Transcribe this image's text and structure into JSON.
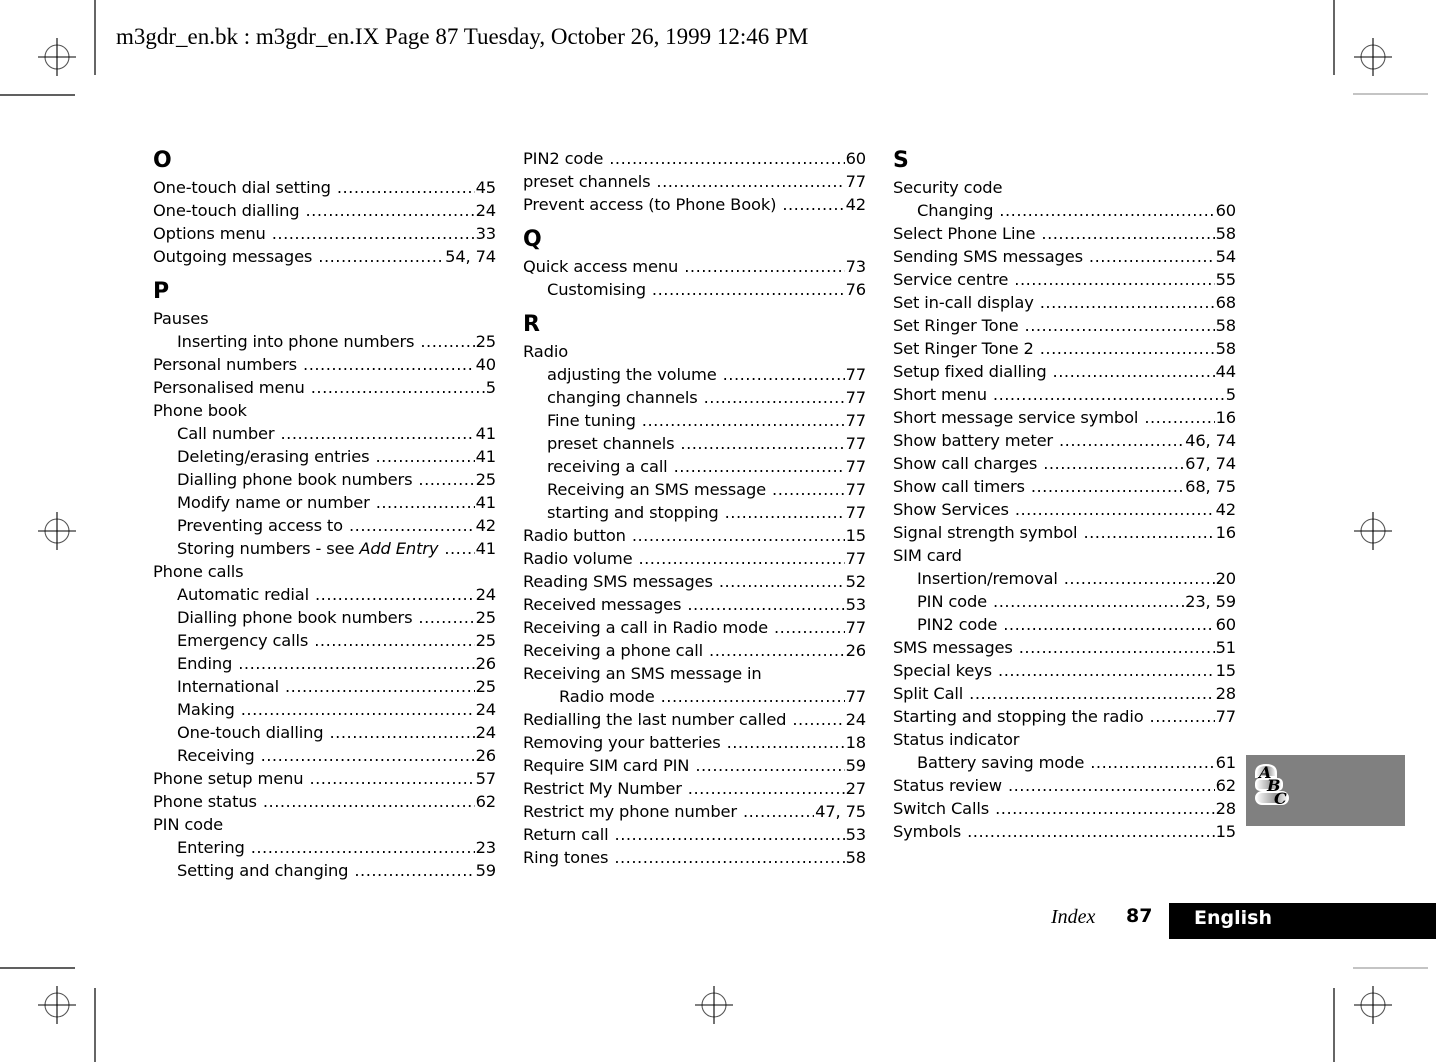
{
  "header": {
    "text": "m3gdr_en.bk : m3gdr_en.IX  Page 87  Tuesday, October 26, 1999  12:46 PM"
  },
  "columns": [
    {
      "items": [
        {
          "type": "letter",
          "text": "O"
        },
        {
          "type": "entry",
          "term": "One-touch dial setting",
          "page": "45"
        },
        {
          "type": "entry",
          "term": "One-touch dialling",
          "page": "24"
        },
        {
          "type": "entry",
          "term": "Options menu",
          "page": "33"
        },
        {
          "type": "entry",
          "term": "Outgoing messages",
          "page": "54, 74"
        },
        {
          "type": "letter",
          "text": "P"
        },
        {
          "type": "heading",
          "term": "Pauses"
        },
        {
          "type": "sub",
          "term": "Inserting into phone numbers",
          "page": "25"
        },
        {
          "type": "entry",
          "term": "Personal numbers",
          "page": "40"
        },
        {
          "type": "entry",
          "term": "Personalised menu",
          "page": "5"
        },
        {
          "type": "heading",
          "term": "Phone book"
        },
        {
          "type": "sub",
          "term": "Call number",
          "page": "41"
        },
        {
          "type": "sub",
          "term": "Deleting/erasing entries",
          "page": "41"
        },
        {
          "type": "sub",
          "term": "Dialling phone book numbers",
          "page": "25"
        },
        {
          "type": "sub",
          "term": "Modify name or number",
          "page": "41"
        },
        {
          "type": "sub",
          "term": "Preventing access to",
          "page": "42"
        },
        {
          "type": "sub",
          "term": "Storing numbers - see ",
          "term_italic": "Add Entry",
          "page": "41"
        },
        {
          "type": "heading",
          "term": "Phone calls"
        },
        {
          "type": "sub",
          "term": "Automatic redial",
          "page": "24"
        },
        {
          "type": "sub",
          "term": "Dialling phone book numbers",
          "page": "25"
        },
        {
          "type": "sub",
          "term": "Emergency calls",
          "page": "25"
        },
        {
          "type": "sub",
          "term": "Ending",
          "page": "26"
        },
        {
          "type": "sub",
          "term": "International",
          "page": "25"
        },
        {
          "type": "sub",
          "term": "Making",
          "page": "24"
        },
        {
          "type": "sub",
          "term": "One-touch dialling",
          "page": "24"
        },
        {
          "type": "sub",
          "term": "Receiving",
          "page": "26"
        },
        {
          "type": "entry",
          "term": "Phone setup menu",
          "page": "57"
        },
        {
          "type": "entry",
          "term": "Phone status",
          "page": "62"
        },
        {
          "type": "heading",
          "term": "PIN code"
        },
        {
          "type": "sub",
          "term": "Entering",
          "page": "23"
        },
        {
          "type": "sub",
          "term": "Setting and changing",
          "page": "59"
        }
      ]
    },
    {
      "items": [
        {
          "type": "entry",
          "term": "PIN2 code",
          "page": "60"
        },
        {
          "type": "entry",
          "term": "preset channels",
          "page": "77"
        },
        {
          "type": "entry",
          "term": "Prevent access (to Phone Book)",
          "page": "42"
        },
        {
          "type": "letter",
          "text": "Q"
        },
        {
          "type": "entry",
          "term": "Quick access menu",
          "page": "73"
        },
        {
          "type": "sub",
          "term": "Customising",
          "page": "76"
        },
        {
          "type": "letter",
          "text": "R"
        },
        {
          "type": "heading",
          "term": "Radio"
        },
        {
          "type": "sub",
          "term": "adjusting the volume",
          "page": "77"
        },
        {
          "type": "sub",
          "term": "changing channels",
          "page": "77"
        },
        {
          "type": "sub",
          "term": "Fine tuning",
          "page": "77"
        },
        {
          "type": "sub",
          "term": "preset channels",
          "page": "77"
        },
        {
          "type": "sub",
          "term": "receiving a call",
          "page": "77"
        },
        {
          "type": "sub",
          "term": "Receiving an SMS message",
          "page": "77"
        },
        {
          "type": "sub",
          "term": "starting and stopping",
          "page": "77"
        },
        {
          "type": "entry",
          "term": "Radio button",
          "page": "15"
        },
        {
          "type": "entry",
          "term": "Radio volume",
          "page": "77"
        },
        {
          "type": "entry",
          "term": "Reading SMS messages",
          "page": "52"
        },
        {
          "type": "entry",
          "term": "Received messages",
          "page": "53"
        },
        {
          "type": "entry",
          "term": "Receiving a call in Radio mode",
          "page": "77"
        },
        {
          "type": "entry",
          "term": "Receiving a phone call",
          "page": "26"
        },
        {
          "type": "heading",
          "term": "Receiving an SMS message in"
        },
        {
          "type": "sub2",
          "term": "Radio mode",
          "page": "77"
        },
        {
          "type": "entry",
          "term": "Redialling the last number called",
          "page": "24"
        },
        {
          "type": "entry",
          "term": "Removing your batteries",
          "page": "18"
        },
        {
          "type": "entry",
          "term": "Require SIM card PIN",
          "page": "59"
        },
        {
          "type": "entry",
          "term": "Restrict My Number",
          "page": "27"
        },
        {
          "type": "entry",
          "term": "Restrict my phone number",
          "page": "47, 75"
        },
        {
          "type": "entry",
          "term": "Return call",
          "page": "53"
        },
        {
          "type": "entry",
          "term": "Ring tones",
          "page": "58"
        }
      ]
    },
    {
      "items": [
        {
          "type": "letter",
          "text": "S"
        },
        {
          "type": "heading",
          "term": "Security code"
        },
        {
          "type": "sub",
          "term": "Changing",
          "page": "60"
        },
        {
          "type": "entry",
          "term": "Select Phone Line",
          "page": "58"
        },
        {
          "type": "entry",
          "term": "Sending SMS messages",
          "page": "54"
        },
        {
          "type": "entry",
          "term": "Service centre",
          "page": "55"
        },
        {
          "type": "entry",
          "term": "Set in-call display",
          "page": "68"
        },
        {
          "type": "entry",
          "term": "Set Ringer Tone",
          "page": "58"
        },
        {
          "type": "entry",
          "term": "Set Ringer Tone 2",
          "page": "58"
        },
        {
          "type": "entry",
          "term": "Setup fixed dialling",
          "page": "44"
        },
        {
          "type": "entry",
          "term": "Short menu",
          "page": "5"
        },
        {
          "type": "entry",
          "term": "Short message service symbol",
          "page": "16"
        },
        {
          "type": "entry",
          "term": "Show battery meter",
          "page": "46, 74"
        },
        {
          "type": "entry",
          "term": "Show call charges",
          "page": "67, 74"
        },
        {
          "type": "entry",
          "term": "Show call timers",
          "page": "68, 75"
        },
        {
          "type": "entry",
          "term": "Show Services",
          "page": "42"
        },
        {
          "type": "entry",
          "term": "Signal strength symbol",
          "page": "16"
        },
        {
          "type": "heading",
          "term": "SIM card"
        },
        {
          "type": "sub",
          "term": "Insertion/removal",
          "page": "20"
        },
        {
          "type": "sub",
          "term": "PIN code",
          "page": "23, 59"
        },
        {
          "type": "sub",
          "term": "PIN2 code",
          "page": "60"
        },
        {
          "type": "entry",
          "term": "SMS messages",
          "page": "51"
        },
        {
          "type": "entry",
          "term": "Special keys",
          "page": "15"
        },
        {
          "type": "entry",
          "term": "Split Call",
          "page": "28"
        },
        {
          "type": "entry",
          "term": "Starting and stopping the radio",
          "page": "77"
        },
        {
          "type": "heading",
          "term": "Status indicator"
        },
        {
          "type": "sub",
          "term": "Battery saving mode",
          "page": "61"
        },
        {
          "type": "entry",
          "term": "Status review",
          "page": "62"
        },
        {
          "type": "entry",
          "term": "Switch Calls",
          "page": "28"
        },
        {
          "type": "entry",
          "term": "Symbols",
          "page": "15"
        }
      ]
    }
  ],
  "abc_tab": {
    "icon": "abc-index-icon",
    "letters": [
      "A",
      "B",
      "C"
    ],
    "background": "#808080"
  },
  "footer": {
    "section_label": "Index",
    "page_number": "87",
    "language_label": "English",
    "language_bar_color": "#000000"
  }
}
